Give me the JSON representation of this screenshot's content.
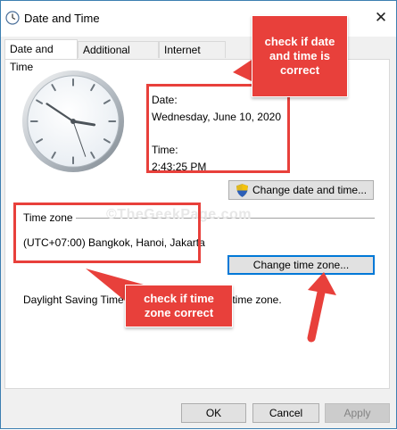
{
  "window": {
    "title": "Date and Time",
    "close_symbol": "✕"
  },
  "tabs": [
    {
      "label": "Date and Time",
      "active": true
    },
    {
      "label": "Additional Clocks",
      "active": false
    },
    {
      "label": "Internet Time",
      "active": false
    }
  ],
  "datetime": {
    "date_label": "Date:",
    "date_value": "Wednesday, June 10, 2020",
    "time_label": "Time:",
    "time_value": "2:43:25 PM",
    "change_button": "Change date and time..."
  },
  "timezone": {
    "section_label": "Time zone",
    "value": "(UTC+07:00) Bangkok, Hanoi, Jakarta",
    "change_button": "Change time zone...",
    "dst_text_left": "Daylight Saving Time",
    "dst_text_right": "s time zone."
  },
  "watermark": "©TheGeekPage.com",
  "annotations": {
    "top_callout": "check if date and time is correct",
    "bottom_callout": "check if time zone correct",
    "color": "#e8403b"
  },
  "footer": {
    "ok": "OK",
    "cancel": "Cancel",
    "apply": "Apply"
  },
  "icons": {
    "app": "clock-icon",
    "shield": "uac-shield-icon"
  }
}
